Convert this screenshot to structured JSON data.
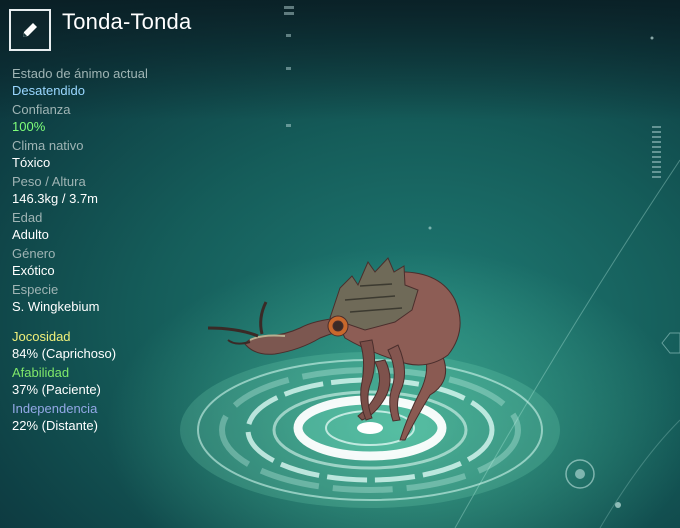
{
  "creature": {
    "name": "Tonda-Tonda"
  },
  "stats": {
    "mood": {
      "label": "Estado de ánimo actual",
      "value": "Desatendido",
      "color": "#9ad7ff"
    },
    "trust": {
      "label": "Confianza",
      "value": "100%",
      "color": "#7fff7a"
    },
    "climate": {
      "label": "Clima nativo",
      "value": "Tóxico"
    },
    "weight_height": {
      "label": "Peso / Altura",
      "value": "146.3kg / 3.7m"
    },
    "age": {
      "label": "Edad",
      "value": "Adulto"
    },
    "gender": {
      "label": "Género",
      "value": "Exótico"
    },
    "species": {
      "label": "Especie",
      "value": "S. Wingkebium"
    }
  },
  "traits": {
    "playfulness": {
      "label": "Jocosidad",
      "value": "84% (Caprichoso)",
      "color": "#f1f07a"
    },
    "affability": {
      "label": "Afabilidad",
      "value": "37% (Paciente)",
      "color": "#7fe86a"
    },
    "independence": {
      "label": "Independencia",
      "value": "22% (Distante)",
      "color": "#93a8e6"
    }
  },
  "icons": {
    "edit": "pencil-icon"
  }
}
